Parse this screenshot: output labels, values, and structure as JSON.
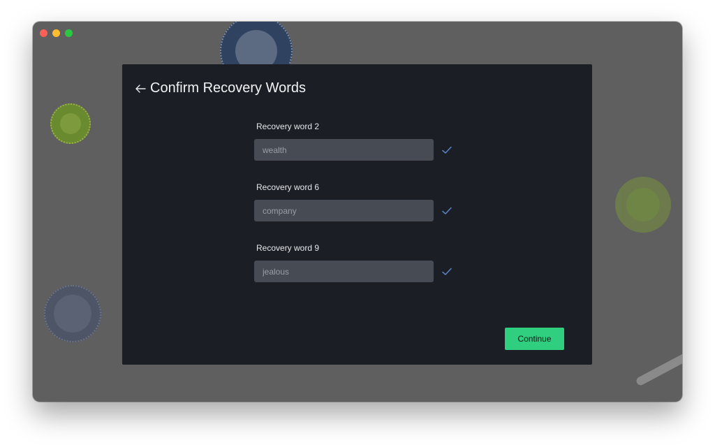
{
  "window": {
    "traffic_lights": [
      "close",
      "minimize",
      "zoom"
    ]
  },
  "dialog": {
    "back_icon": "arrow-left-icon",
    "title": "Confirm Recovery Words",
    "fields": [
      {
        "label": "Recovery word 2",
        "value": "wealth",
        "status_icon": "check-icon"
      },
      {
        "label": "Recovery word 6",
        "value": "company",
        "status_icon": "check-icon"
      },
      {
        "label": "Recovery word 9",
        "value": "jealous",
        "status_icon": "check-icon"
      }
    ],
    "continue_label": "Continue"
  },
  "colors": {
    "accent": "#2fcf7f",
    "check": "#5b84c4",
    "dialog_bg": "#1b1e25"
  }
}
